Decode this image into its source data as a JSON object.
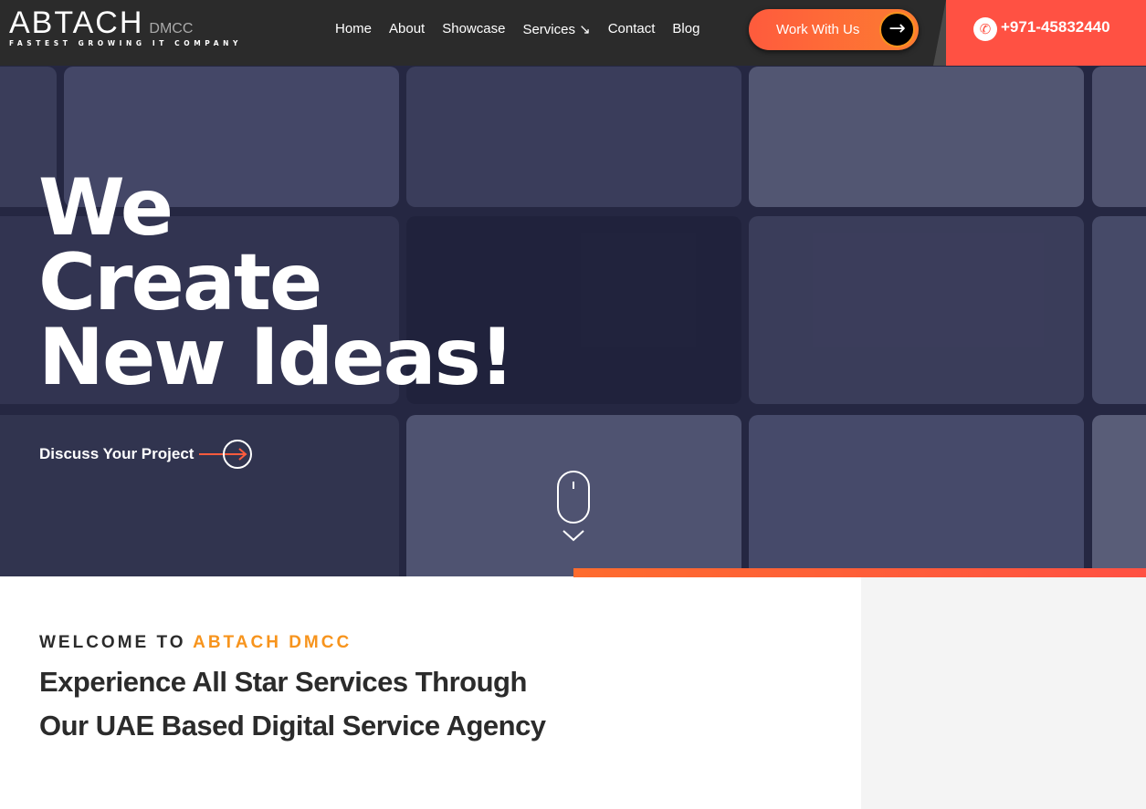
{
  "header": {
    "logo": {
      "text": "ABTACH",
      "suffix": "DMCC",
      "tagline": "FASTEST GROWING IT COMPANY"
    },
    "nav": [
      {
        "label": "Home"
      },
      {
        "label": "About"
      },
      {
        "label": "Showcase"
      },
      {
        "label": "Services ↘"
      },
      {
        "label": "Contact"
      },
      {
        "label": "Blog"
      }
    ],
    "cta_label": "Work With Us",
    "phone": "+971-45832440"
  },
  "hero": {
    "title_lines": [
      "We",
      "Create",
      "New Ideas!"
    ],
    "discuss_label": "Discuss Your Project"
  },
  "welcome": {
    "kicker_prefix": "WELCOME TO ",
    "kicker_highlight": "ABTACH DMCC",
    "heading_line1": "Experience All Star Services Through",
    "heading_line2": "Our UAE Based Digital Service Agency"
  },
  "colors": {
    "accent": "#f7941d",
    "phone_bg": "#ff5143",
    "header_bg": "#2b2b2b"
  }
}
